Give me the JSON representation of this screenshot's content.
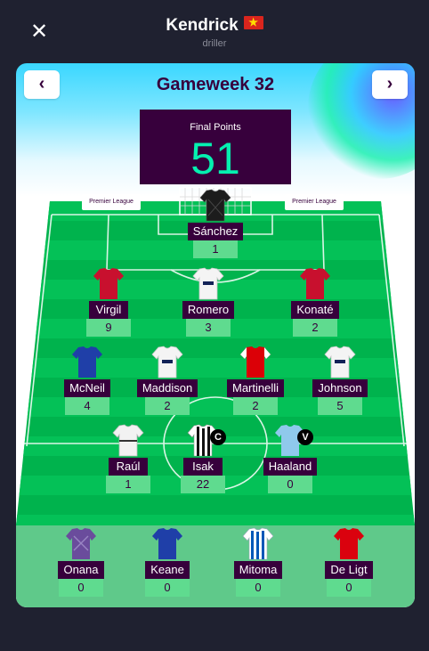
{
  "header": {
    "close_icon": "close-icon",
    "manager_name": "Kendrick",
    "flag_icon": "vietnam-flag-icon",
    "team_name": "driller"
  },
  "gameweek": {
    "prev_icon": "chevron-left-icon",
    "next_icon": "chevron-right-icon",
    "title": "Gameweek 32",
    "points_label": "Final Points",
    "points_value": "51"
  },
  "boards": {
    "left": "Premier League",
    "right": "Premier League"
  },
  "colors": {
    "primary": "#37003c",
    "accent": "#05f0b0",
    "pitch": "#00b34d",
    "bench": "#5fc98a"
  },
  "starting": {
    "gk": [
      {
        "name": "Sánchez",
        "points": "1",
        "kit": "gk-black"
      }
    ],
    "def": [
      {
        "name": "Virgil",
        "points": "9",
        "kit": "red"
      },
      {
        "name": "Romero",
        "points": "3",
        "kit": "white"
      },
      {
        "name": "Konaté",
        "points": "2",
        "kit": "red"
      }
    ],
    "mid": [
      {
        "name": "McNeil",
        "points": "4",
        "kit": "blue"
      },
      {
        "name": "Maddison",
        "points": "2",
        "kit": "white"
      },
      {
        "name": "Martinelli",
        "points": "2",
        "kit": "red-white"
      },
      {
        "name": "Johnson",
        "points": "5",
        "kit": "white"
      }
    ],
    "fwd": [
      {
        "name": "Raúl",
        "points": "1",
        "kit": "white-black"
      },
      {
        "name": "Isak",
        "points": "22",
        "kit": "stripes",
        "armband": "C"
      },
      {
        "name": "Haaland",
        "points": "0",
        "kit": "skyblue",
        "armband": "V"
      }
    ]
  },
  "bench": [
    {
      "name": "Onana",
      "points": "0",
      "kit": "gk-purple"
    },
    {
      "name": "Keane",
      "points": "0",
      "kit": "blue"
    },
    {
      "name": "Mitoma",
      "points": "0",
      "kit": "blue-stripes"
    },
    {
      "name": "De Ligt",
      "points": "0",
      "kit": "red"
    }
  ]
}
